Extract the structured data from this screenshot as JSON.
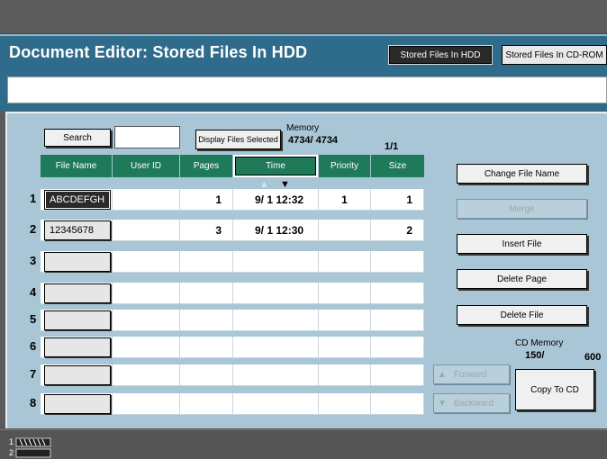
{
  "header": {
    "title": "Document Editor: Stored Files In HDD",
    "tabs": [
      "Stored Files In HDD",
      "Stored Files In CD-ROM"
    ]
  },
  "search": {
    "label": "Search",
    "value": ""
  },
  "display_selected_label": "Display Files Selected",
  "memory": {
    "label": "Memory",
    "value": "4734/  4734",
    "page": "1/1"
  },
  "columns": [
    "File Name",
    "User ID",
    "Pages",
    "Time",
    "Priority",
    "Size"
  ],
  "rows": [
    {
      "num": "1",
      "file": "ABCDEFGH",
      "user": "",
      "pages": "1",
      "time": "9/ 1 12:32",
      "priority": "1",
      "size": "1"
    },
    {
      "num": "2",
      "file": "12345678",
      "user": "",
      "pages": "3",
      "time": "9/ 1 12:30",
      "priority": "",
      "size": "2"
    },
    {
      "num": "3",
      "file": "",
      "user": "",
      "pages": "",
      "time": "",
      "priority": "",
      "size": ""
    },
    {
      "num": "4",
      "file": "",
      "user": "",
      "pages": "",
      "time": "",
      "priority": "",
      "size": ""
    },
    {
      "num": "5",
      "file": "",
      "user": "",
      "pages": "",
      "time": "",
      "priority": "",
      "size": ""
    },
    {
      "num": "6",
      "file": "",
      "user": "",
      "pages": "",
      "time": "",
      "priority": "",
      "size": ""
    },
    {
      "num": "7",
      "file": "",
      "user": "",
      "pages": "",
      "time": "",
      "priority": "",
      "size": ""
    },
    {
      "num": "8",
      "file": "",
      "user": "",
      "pages": "",
      "time": "",
      "priority": "",
      "size": ""
    }
  ],
  "side": {
    "change_name": "Change File Name",
    "merge": "Merge",
    "insert": "Insert File",
    "delete_page": "Delete Page",
    "delete_file": "Delete File"
  },
  "cd_memory": {
    "label": "CD Memory",
    "value": "150/",
    "total": "600"
  },
  "nav": {
    "forward": "Forward",
    "backward": "Backward"
  },
  "copy_cd": "Copy To CD",
  "taskbar": {
    "labels": [
      "1",
      "2"
    ]
  },
  "colors": {
    "header": "#2f6b8a",
    "panel": "#a9c6d6",
    "column_header": "#1f7a5a"
  }
}
